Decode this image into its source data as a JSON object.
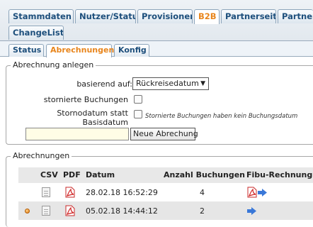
{
  "tabs_row1": [
    {
      "label": "Stammdaten",
      "active": false
    },
    {
      "label": "Nutzer/Status",
      "active": false
    },
    {
      "label": "Provisionen",
      "active": false
    },
    {
      "label": "B2B",
      "active": true
    },
    {
      "label": "Partnerseite",
      "active": false
    },
    {
      "label": "Partner",
      "active": false
    }
  ],
  "tabs_row2": [
    {
      "label": "ChangeList",
      "active": false
    }
  ],
  "subtabs": [
    {
      "label": "Status",
      "active": false
    },
    {
      "label": "Abrechnungen",
      "active": true
    },
    {
      "label": "Konfig",
      "active": false
    }
  ],
  "anlegen": {
    "legend": "Abrechnung anlegen",
    "basis_label": "basierend auf:",
    "basis_value": "Rückreisedatum",
    "storniert_label": "stornierte Buchungen",
    "stornodatum_label_line1": "Stornodatum statt",
    "stornodatum_label_line2": "Basisdatum",
    "stornodatum_hint": "Stornierte Buchungen haben kein Buchungsdatum",
    "input_value": "",
    "button_label": "Neue Abrechung"
  },
  "abrechnungen": {
    "legend": "Abrechnungen",
    "columns": [
      "CSV",
      "PDF",
      "Datum",
      "Anzahl Buchungen",
      "Fibu-Rechnung"
    ],
    "rows": [
      {
        "datum": "28.02.18 16:52:29",
        "anzahl": "4",
        "marker": false,
        "fibu_pdf": true
      },
      {
        "datum": "05.02.18 14:44:12",
        "anzahl": "2",
        "marker": true,
        "fibu_pdf": false
      }
    ]
  },
  "colors": {
    "accent": "#e8851c",
    "tab_text": "#1d4f7c",
    "pdf_red": "#d02020",
    "arrow_blue": "#3a78d8"
  }
}
